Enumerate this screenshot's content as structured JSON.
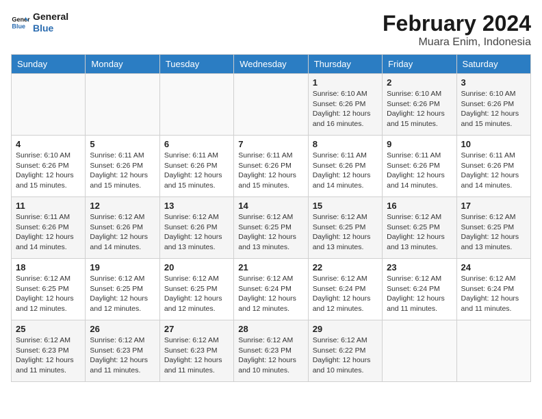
{
  "header": {
    "logo_line1": "General",
    "logo_line2": "Blue",
    "month_year": "February 2024",
    "location": "Muara Enim, Indonesia"
  },
  "weekdays": [
    "Sunday",
    "Monday",
    "Tuesday",
    "Wednesday",
    "Thursday",
    "Friday",
    "Saturday"
  ],
  "weeks": [
    [
      {
        "day": "",
        "info": ""
      },
      {
        "day": "",
        "info": ""
      },
      {
        "day": "",
        "info": ""
      },
      {
        "day": "",
        "info": ""
      },
      {
        "day": "1",
        "info": "Sunrise: 6:10 AM\nSunset: 6:26 PM\nDaylight: 12 hours\nand 16 minutes."
      },
      {
        "day": "2",
        "info": "Sunrise: 6:10 AM\nSunset: 6:26 PM\nDaylight: 12 hours\nand 15 minutes."
      },
      {
        "day": "3",
        "info": "Sunrise: 6:10 AM\nSunset: 6:26 PM\nDaylight: 12 hours\nand 15 minutes."
      }
    ],
    [
      {
        "day": "4",
        "info": "Sunrise: 6:10 AM\nSunset: 6:26 PM\nDaylight: 12 hours\nand 15 minutes."
      },
      {
        "day": "5",
        "info": "Sunrise: 6:11 AM\nSunset: 6:26 PM\nDaylight: 12 hours\nand 15 minutes."
      },
      {
        "day": "6",
        "info": "Sunrise: 6:11 AM\nSunset: 6:26 PM\nDaylight: 12 hours\nand 15 minutes."
      },
      {
        "day": "7",
        "info": "Sunrise: 6:11 AM\nSunset: 6:26 PM\nDaylight: 12 hours\nand 15 minutes."
      },
      {
        "day": "8",
        "info": "Sunrise: 6:11 AM\nSunset: 6:26 PM\nDaylight: 12 hours\nand 14 minutes."
      },
      {
        "day": "9",
        "info": "Sunrise: 6:11 AM\nSunset: 6:26 PM\nDaylight: 12 hours\nand 14 minutes."
      },
      {
        "day": "10",
        "info": "Sunrise: 6:11 AM\nSunset: 6:26 PM\nDaylight: 12 hours\nand 14 minutes."
      }
    ],
    [
      {
        "day": "11",
        "info": "Sunrise: 6:11 AM\nSunset: 6:26 PM\nDaylight: 12 hours\nand 14 minutes."
      },
      {
        "day": "12",
        "info": "Sunrise: 6:12 AM\nSunset: 6:26 PM\nDaylight: 12 hours\nand 14 minutes."
      },
      {
        "day": "13",
        "info": "Sunrise: 6:12 AM\nSunset: 6:26 PM\nDaylight: 12 hours\nand 13 minutes."
      },
      {
        "day": "14",
        "info": "Sunrise: 6:12 AM\nSunset: 6:25 PM\nDaylight: 12 hours\nand 13 minutes."
      },
      {
        "day": "15",
        "info": "Sunrise: 6:12 AM\nSunset: 6:25 PM\nDaylight: 12 hours\nand 13 minutes."
      },
      {
        "day": "16",
        "info": "Sunrise: 6:12 AM\nSunset: 6:25 PM\nDaylight: 12 hours\nand 13 minutes."
      },
      {
        "day": "17",
        "info": "Sunrise: 6:12 AM\nSunset: 6:25 PM\nDaylight: 12 hours\nand 13 minutes."
      }
    ],
    [
      {
        "day": "18",
        "info": "Sunrise: 6:12 AM\nSunset: 6:25 PM\nDaylight: 12 hours\nand 12 minutes."
      },
      {
        "day": "19",
        "info": "Sunrise: 6:12 AM\nSunset: 6:25 PM\nDaylight: 12 hours\nand 12 minutes."
      },
      {
        "day": "20",
        "info": "Sunrise: 6:12 AM\nSunset: 6:25 PM\nDaylight: 12 hours\nand 12 minutes."
      },
      {
        "day": "21",
        "info": "Sunrise: 6:12 AM\nSunset: 6:24 PM\nDaylight: 12 hours\nand 12 minutes."
      },
      {
        "day": "22",
        "info": "Sunrise: 6:12 AM\nSunset: 6:24 PM\nDaylight: 12 hours\nand 12 minutes."
      },
      {
        "day": "23",
        "info": "Sunrise: 6:12 AM\nSunset: 6:24 PM\nDaylight: 12 hours\nand 11 minutes."
      },
      {
        "day": "24",
        "info": "Sunrise: 6:12 AM\nSunset: 6:24 PM\nDaylight: 12 hours\nand 11 minutes."
      }
    ],
    [
      {
        "day": "25",
        "info": "Sunrise: 6:12 AM\nSunset: 6:23 PM\nDaylight: 12 hours\nand 11 minutes."
      },
      {
        "day": "26",
        "info": "Sunrise: 6:12 AM\nSunset: 6:23 PM\nDaylight: 12 hours\nand 11 minutes."
      },
      {
        "day": "27",
        "info": "Sunrise: 6:12 AM\nSunset: 6:23 PM\nDaylight: 12 hours\nand 11 minutes."
      },
      {
        "day": "28",
        "info": "Sunrise: 6:12 AM\nSunset: 6:23 PM\nDaylight: 12 hours\nand 10 minutes."
      },
      {
        "day": "29",
        "info": "Sunrise: 6:12 AM\nSunset: 6:22 PM\nDaylight: 12 hours\nand 10 minutes."
      },
      {
        "day": "",
        "info": ""
      },
      {
        "day": "",
        "info": ""
      }
    ]
  ]
}
